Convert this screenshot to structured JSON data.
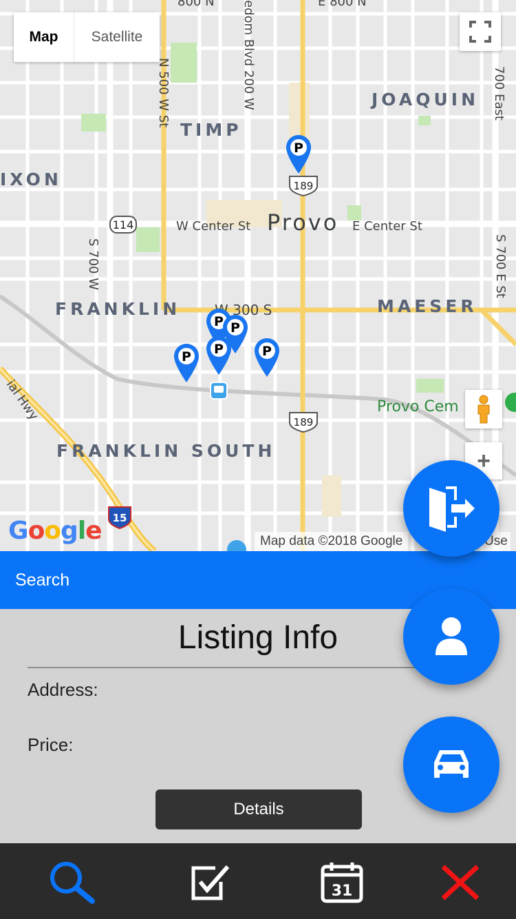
{
  "map": {
    "type_control": {
      "map_label": "Map",
      "satellite_label": "Satellite",
      "selected": "Map"
    },
    "labels": {
      "joaquin": "JOAQUIN",
      "timp": "TIMP",
      "dixon": "IXON",
      "provo": "Provo",
      "franklin": "FRANKLIN",
      "maeser": "MAESER",
      "franklin_south": "FRANKLIN SOUTH",
      "w_center": "W Center St",
      "e_center": "E Center St",
      "w_300s": "W 300 S",
      "n500w": "N 500 W St",
      "s700w": "S 700 W",
      "s700e": "S 700 E St",
      "e700": "700 East",
      "freedom": "edom Blvd 200 W",
      "n800": "800 N",
      "e800": "E 800 N",
      "ial_hwy": "ial Hwy",
      "cemetery": "Provo Cem",
      "route_114": "114",
      "route_189_north": "189",
      "route_189_south": "189",
      "route_15": "15"
    },
    "attribution": "Map data ©2018 Google",
    "terms": "Use",
    "google_logo": [
      "G",
      "o",
      "o",
      "g",
      "l",
      "e"
    ],
    "google_colors": [
      "#4285F4",
      "#EA4335",
      "#FBBC05",
      "#4285F4",
      "#34A853",
      "#EA4335"
    ],
    "pin_icon_letter": "P",
    "pin_color": "#1976f0",
    "zoom_in_label": "+"
  },
  "search_bar": {
    "label": "Search"
  },
  "listing": {
    "title": "Listing Info",
    "address_label": "Address:",
    "price_label": "Price:",
    "details_button": "Details"
  },
  "fabs": [
    "exit-door-icon",
    "person-icon",
    "car-icon"
  ],
  "bottom_nav": {
    "items": [
      "search-icon",
      "checkbox-icon",
      "calendar-icon",
      "close-icon"
    ],
    "calendar_day": "31",
    "active": "search-icon",
    "colors": {
      "active": "#0a74f9",
      "default": "#ffffff",
      "close": "#f01414"
    }
  },
  "accent": "#0a74f9"
}
